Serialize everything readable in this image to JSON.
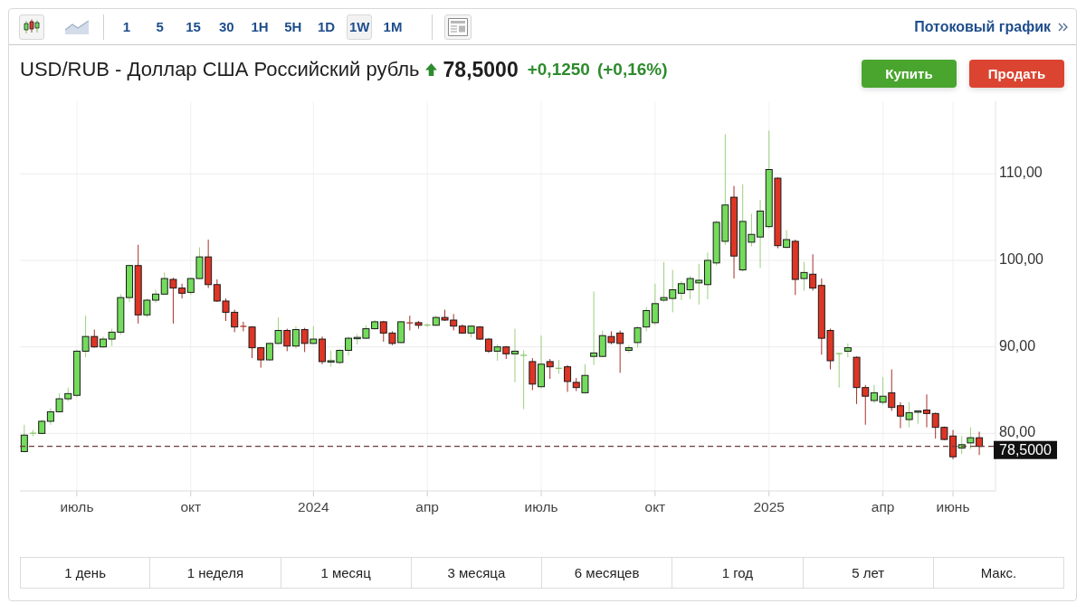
{
  "toolbar": {
    "chart_types": [
      {
        "kind": "candlestick",
        "selected": true
      },
      {
        "kind": "area",
        "selected": false
      }
    ],
    "intervals": [
      {
        "label": "1",
        "selected": false
      },
      {
        "label": "5",
        "selected": false
      },
      {
        "label": "15",
        "selected": false
      },
      {
        "label": "30",
        "selected": false
      },
      {
        "label": "1H",
        "selected": false
      },
      {
        "label": "5H",
        "selected": false
      },
      {
        "label": "1D",
        "selected": false
      },
      {
        "label": "1W",
        "selected": true
      },
      {
        "label": "1M",
        "selected": false
      }
    ],
    "streaming_link": "Потоковый график"
  },
  "header": {
    "title": "USD/RUB - Доллар США Российский рубль",
    "positive": true,
    "price": "78,5000",
    "change": "+0,1250",
    "change_percent": "(+0,16%)",
    "buttons": [
      {
        "kind": "buy",
        "label": "Купить"
      },
      {
        "kind": "sell",
        "label": "Продать"
      }
    ]
  },
  "chart": {
    "chart_data": {
      "type": "candlestick",
      "categories": [
        null,
        null,
        null,
        null,
        null,
        null,
        "июль",
        null,
        null,
        null,
        null,
        null,
        null,
        null,
        null,
        null,
        null,
        null,
        null,
        "окт",
        null,
        null,
        null,
        null,
        null,
        null,
        null,
        null,
        null,
        null,
        null,
        null,
        null,
        "2024",
        null,
        null,
        null,
        null,
        null,
        null,
        null,
        null,
        null,
        null,
        null,
        null,
        "апр",
        null,
        null,
        null,
        null,
        null,
        null,
        null,
        null,
        null,
        null,
        null,
        null,
        "июль",
        null,
        null,
        null,
        null,
        null,
        null,
        null,
        null,
        null,
        null,
        null,
        null,
        "окт",
        null,
        null,
        null,
        null,
        null,
        null,
        null,
        null,
        null,
        null,
        null,
        null,
        "2025",
        null,
        null,
        null,
        null,
        null,
        null,
        null,
        null,
        null,
        null,
        null,
        null,
        "апр",
        null,
        null,
        null,
        null,
        null,
        null,
        null,
        "июнь",
        null,
        null,
        null
      ],
      "ohlc": [
        [
          77.9,
          81.0,
          77.8,
          79.8
        ],
        [
          80.0,
          80.4,
          79.7,
          80.05
        ],
        [
          80.0,
          81.6,
          79.9,
          81.4
        ],
        [
          81.4,
          82.9,
          81.0,
          82.5
        ],
        [
          82.5,
          84.6,
          82.4,
          84.0
        ],
        [
          84.0,
          85.3,
          83.7,
          84.6
        ],
        [
          84.4,
          89.7,
          84.2,
          89.5
        ],
        [
          89.5,
          93.6,
          88.8,
          91.2
        ],
        [
          91.2,
          92.0,
          89.9,
          90.0
        ],
        [
          90.0,
          91.2,
          89.9,
          90.9
        ],
        [
          90.9,
          92.1,
          90.1,
          91.7
        ],
        [
          91.7,
          96.1,
          91.4,
          95.7
        ],
        [
          95.7,
          99.5,
          95.2,
          99.4
        ],
        [
          99.4,
          101.8,
          92.7,
          93.7
        ],
        [
          93.7,
          95.6,
          93.4,
          95.4
        ],
        [
          95.4,
          96.6,
          95.1,
          96.1
        ],
        [
          96.1,
          98.6,
          96.0,
          97.9
        ],
        [
          97.8,
          98.0,
          92.7,
          96.8
        ],
        [
          96.8,
          97.3,
          95.6,
          96.2
        ],
        [
          96.3,
          98.0,
          96.0,
          97.9
        ],
        [
          97.9,
          101.5,
          97.8,
          100.4
        ],
        [
          100.4,
          102.4,
          96.8,
          97.2
        ],
        [
          97.2,
          97.8,
          95.2,
          95.3
        ],
        [
          95.3,
          95.6,
          93.0,
          94.0
        ],
        [
          94.0,
          94.3,
          91.7,
          92.3
        ],
        [
          92.4,
          92.9,
          91.8,
          92.35
        ],
        [
          92.3,
          92.4,
          88.7,
          89.9
        ],
        [
          89.9,
          90.0,
          87.6,
          88.5
        ],
        [
          88.5,
          90.5,
          88.4,
          90.4
        ],
        [
          90.4,
          93.4,
          90.3,
          91.9
        ],
        [
          91.9,
          92.1,
          89.5,
          90.1
        ],
        [
          90.1,
          92.4,
          89.8,
          92.0
        ],
        [
          92.0,
          92.2,
          89.4,
          90.4
        ],
        [
          90.4,
          92.4,
          90.3,
          90.9
        ],
        [
          90.9,
          91.2,
          88.0,
          88.3
        ],
        [
          88.3,
          89.6,
          87.7,
          88.4
        ],
        [
          88.2,
          89.7,
          88.0,
          89.6
        ],
        [
          89.6,
          91.2,
          89.0,
          91.0
        ],
        [
          91.0,
          91.5,
          90.3,
          91.1
        ],
        [
          91.0,
          92.5,
          90.9,
          92.1
        ],
        [
          92.1,
          93.1,
          92.0,
          92.9
        ],
        [
          92.9,
          93.0,
          90.6,
          91.6
        ],
        [
          91.6,
          91.8,
          90.2,
          90.4
        ],
        [
          90.5,
          93.0,
          90.4,
          92.9
        ],
        [
          92.8,
          93.6,
          91.9,
          92.75
        ],
        [
          92.8,
          93.0,
          92.1,
          92.5
        ],
        [
          92.5,
          92.7,
          92.3,
          92.55
        ],
        [
          92.5,
          93.6,
          92.4,
          93.4
        ],
        [
          93.4,
          94.3,
          93.0,
          93.1
        ],
        [
          93.1,
          93.8,
          91.9,
          92.4
        ],
        [
          92.4,
          92.6,
          91.5,
          91.6
        ],
        [
          91.6,
          92.5,
          91.1,
          92.4
        ],
        [
          92.3,
          92.4,
          90.8,
          90.9
        ],
        [
          90.9,
          91.0,
          89.3,
          89.5
        ],
        [
          89.5,
          90.3,
          88.4,
          90.0
        ],
        [
          90.0,
          90.1,
          88.6,
          89.2
        ],
        [
          89.2,
          92.1,
          85.9,
          89.5
        ],
        [
          89.0,
          89.6,
          82.8,
          89.05
        ],
        [
          88.3,
          88.7,
          85.0,
          85.7
        ],
        [
          85.4,
          91.3,
          85.2,
          88.0
        ],
        [
          88.3,
          88.6,
          86.3,
          87.7
        ],
        [
          87.5,
          88.5,
          86.9,
          87.55
        ],
        [
          87.7,
          87.9,
          84.8,
          86.0
        ],
        [
          85.9,
          86.4,
          84.9,
          85.3
        ],
        [
          84.7,
          88.0,
          84.6,
          86.7
        ],
        [
          88.9,
          96.4,
          87.9,
          89.3
        ],
        [
          88.9,
          91.9,
          88.8,
          91.3
        ],
        [
          91.2,
          91.8,
          90.3,
          90.5
        ],
        [
          91.6,
          91.9,
          87.0,
          90.4
        ],
        [
          89.6,
          90.2,
          89.3,
          89.9
        ],
        [
          90.5,
          92.4,
          89.9,
          92.2
        ],
        [
          92.3,
          94.6,
          91.8,
          94.2
        ],
        [
          92.8,
          97.3,
          92.5,
          95.0
        ],
        [
          95.4,
          99.8,
          95.2,
          95.7
        ],
        [
          95.6,
          98.9,
          94.0,
          96.6
        ],
        [
          96.2,
          97.6,
          95.4,
          97.3
        ],
        [
          96.6,
          98.2,
          95.5,
          97.9
        ],
        [
          97.4,
          99.6,
          94.9,
          97.7
        ],
        [
          97.2,
          100.9,
          95.5,
          100.0
        ],
        [
          99.7,
          104.6,
          99.4,
          104.4
        ],
        [
          102.2,
          114.6,
          101.8,
          106.4
        ],
        [
          107.3,
          108.6,
          97.9,
          100.5
        ],
        [
          98.9,
          108.8,
          98.7,
          104.5
        ],
        [
          102.1,
          105.4,
          101.6,
          103.0
        ],
        [
          102.7,
          107.0,
          99.1,
          105.7
        ],
        [
          103.9,
          115.0,
          103.7,
          110.5
        ],
        [
          109.5,
          109.6,
          101.4,
          101.7
        ],
        [
          101.5,
          103.5,
          101.4,
          102.4
        ],
        [
          102.2,
          102.4,
          96.0,
          97.8
        ],
        [
          97.9,
          99.8,
          96.5,
          98.6
        ],
        [
          98.4,
          100.7,
          96.5,
          96.8
        ],
        [
          97.1,
          97.9,
          89.1,
          91.0
        ],
        [
          91.9,
          92.1,
          87.4,
          88.4
        ],
        [
          89.2,
          89.3,
          85.3,
          89.25
        ],
        [
          89.5,
          90.4,
          88.8,
          89.9
        ],
        [
          88.8,
          88.9,
          83.4,
          85.3
        ],
        [
          85.3,
          85.6,
          81.0,
          84.3
        ],
        [
          83.8,
          85.6,
          83.5,
          84.7
        ],
        [
          83.6,
          86.5,
          83.3,
          84.3
        ],
        [
          84.7,
          87.4,
          82.6,
          83.0
        ],
        [
          83.2,
          83.6,
          80.6,
          82.0
        ],
        [
          81.6,
          83.6,
          80.7,
          82.4
        ],
        [
          82.5,
          82.6,
          81.1,
          82.6
        ],
        [
          82.7,
          84.5,
          80.7,
          82.3
        ],
        [
          82.3,
          82.4,
          79.4,
          80.7
        ],
        [
          80.7,
          80.8,
          79.2,
          79.3
        ],
        [
          79.7,
          80.4,
          77.0,
          77.3
        ],
        [
          78.3,
          79.7,
          77.6,
          78.7
        ],
        [
          78.9,
          80.7,
          78.2,
          79.5
        ],
        [
          79.5,
          80.2,
          77.5,
          78.5
        ]
      ],
      "ylim": [
        73.35,
        118.39
      ],
      "yticks": [
        {
          "value": 110,
          "label": "110,00"
        },
        {
          "value": 100,
          "label": "100,00"
        },
        {
          "value": 90,
          "label": "90,00"
        },
        {
          "value": 80,
          "label": "80,00"
        }
      ],
      "grid": true,
      "ref_lines": [
        {
          "axis": "y",
          "value": 78.5,
          "label": "78,5000"
        }
      ]
    }
  },
  "ranges": [
    {
      "label": "1 день",
      "selected": false
    },
    {
      "label": "1 неделя",
      "selected": false
    },
    {
      "label": "1 месяц",
      "selected": false
    },
    {
      "label": "3 месяца",
      "selected": false
    },
    {
      "label": "6 месяцев",
      "selected": false
    },
    {
      "label": "1 год",
      "selected": false
    },
    {
      "label": "5 лет",
      "selected": false
    },
    {
      "label": "Макс.",
      "selected": false
    }
  ]
}
